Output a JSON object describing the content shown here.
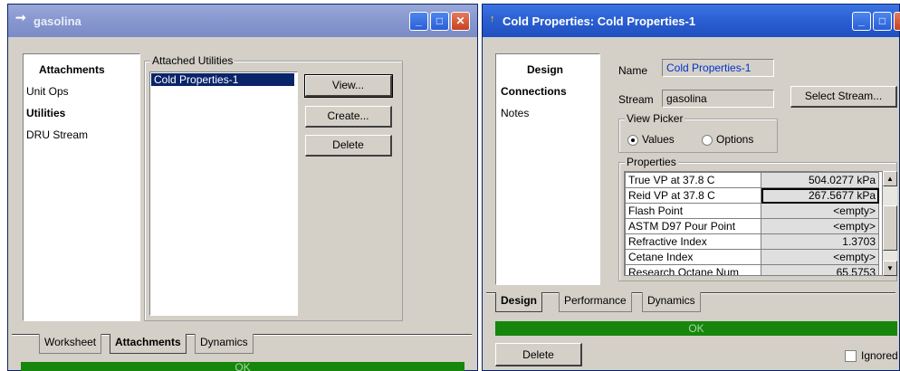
{
  "left_window": {
    "title": "gasolina",
    "nav_title": "Attachments",
    "nav_items": [
      "Unit Ops",
      "Utilities",
      "DRU Stream"
    ],
    "group_label": "Attached Utilities",
    "utilities": [
      "Cold Properties-1"
    ],
    "buttons": {
      "view": "View...",
      "create": "Create...",
      "delete": "Delete"
    },
    "tabs": [
      "Worksheet",
      "Attachments",
      "Dynamics"
    ],
    "status": "OK"
  },
  "right_window": {
    "title": "Cold Properties: Cold Properties-1",
    "nav_items": [
      "Design",
      "Connections",
      "Notes"
    ],
    "name_label": "Name",
    "name_value": "Cold Properties-1",
    "stream_label": "Stream",
    "stream_value": "gasolina",
    "select_stream_label": "Select Stream...",
    "view_picker_label": "View Picker",
    "radio_values": "Values",
    "radio_options": "Options",
    "properties_label": "Properties",
    "properties": [
      {
        "name": "True VP at 37.8 C",
        "value": "504.0277 kPa"
      },
      {
        "name": "Reid VP at 37.8 C",
        "value": "267.5677 kPa"
      },
      {
        "name": "Flash Point",
        "value": "<empty>"
      },
      {
        "name": "ASTM D97 Pour Point",
        "value": "<empty>"
      },
      {
        "name": "Refractive Index",
        "value": "1.3703"
      },
      {
        "name": "Cetane Index",
        "value": "<empty>"
      },
      {
        "name": "Research Octane Num",
        "value": "65.5753"
      }
    ],
    "tabs": [
      "Design",
      "Performance",
      "Dynamics"
    ],
    "status": "OK",
    "delete_label": "Delete",
    "ignored_label": "Ignored"
  }
}
